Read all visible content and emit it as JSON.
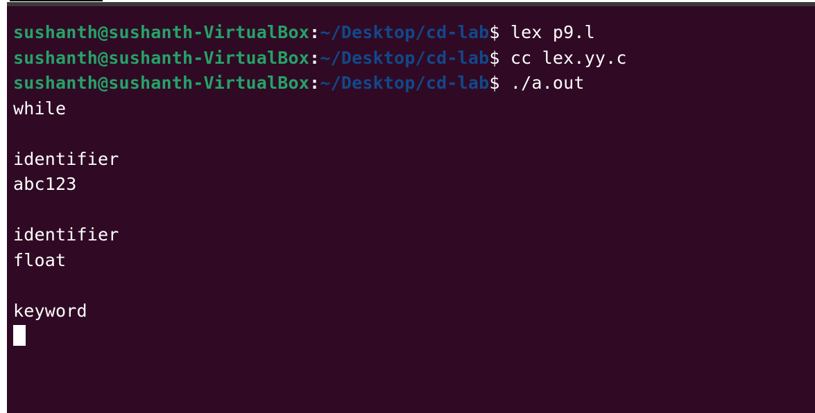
{
  "terminal": {
    "prompt_user_host": "sushanth@sushanth-VirtualBox",
    "prompt_sep": ":",
    "prompt_path": "~/Desktop/cd-lab",
    "prompt_symbol": "$ ",
    "commands": [
      "lex p9.l",
      "cc lex.yy.c",
      "./a.out"
    ],
    "output": [
      "while",
      "",
      "identifier",
      "abc123",
      "",
      "identifier",
      "float",
      "",
      "keyword"
    ]
  },
  "colors": {
    "background": "#300a24",
    "user_host": "#26a269",
    "path": "#12488b",
    "text": "#ffffff"
  },
  "icons": {
    "cursor": "cursor-block-icon"
  }
}
